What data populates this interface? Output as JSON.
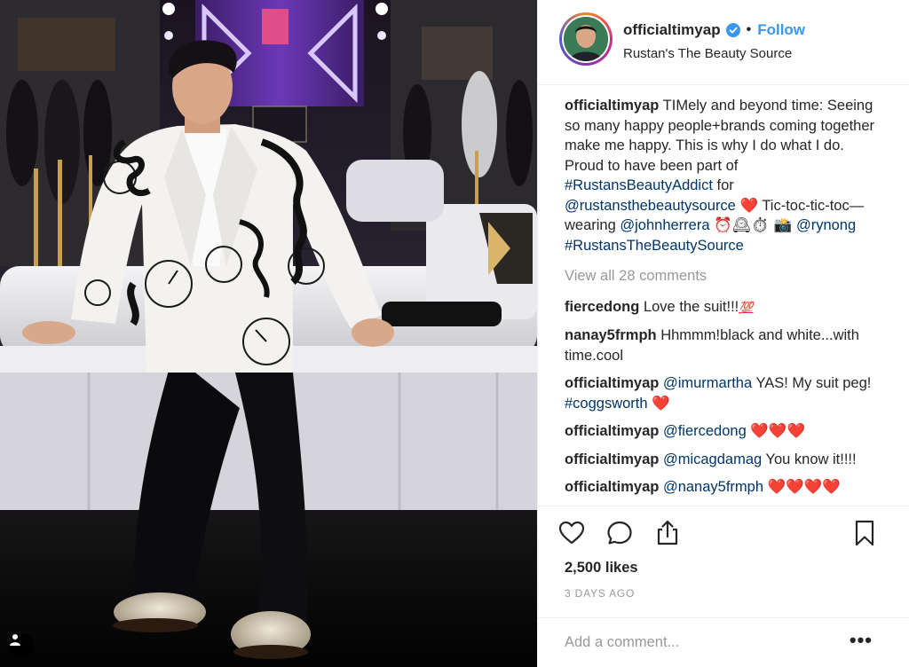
{
  "header": {
    "username": "officialtimyap",
    "follow_label": "Follow",
    "location": "Rustan's The Beauty Source"
  },
  "caption": {
    "username": "officialtimyap",
    "text_1": "TIMely and beyond time: Seeing so many happy people+brands coming together make me happy. This is why I do what I do. Proud to have been part of",
    "hashtag_1": "#RustansBeautyAddict",
    "text_2": "for",
    "mention_1": "@rustansthebeautysource",
    "heart": "❤️",
    "text_3": "Tic-toc-tic-toc—wearing",
    "mention_2": "@johnherrera",
    "emojis": "⏰🕰⏱ 📸",
    "mention_3": "@rynong",
    "hashtag_2": "#RustansTheBeautySource"
  },
  "view_all_label": "View all 28 comments",
  "comments": [
    {
      "username": "fiercedong",
      "text": "Love the suit!!!",
      "emoji": "💯"
    },
    {
      "username": "nanay5frmph",
      "text": "Hhmmm!black and white...with time.cool"
    },
    {
      "username": "officialtimyap",
      "mention": "@imurmartha",
      "text": "YAS! My suit peg!",
      "hashtag": "#coggsworth",
      "emoji": "❤️"
    },
    {
      "username": "officialtimyap",
      "mention": "@fiercedong",
      "emoji": "❤️❤️❤️"
    },
    {
      "username": "officialtimyap",
      "mention": "@micagdamag",
      "text": "You know it!!!!"
    },
    {
      "username": "officialtimyap",
      "mention": "@nanay5frmph",
      "emoji": "❤️❤️❤️❤️"
    }
  ],
  "icons": {
    "like": "heart-outline-icon",
    "comment": "speech-bubble-icon",
    "share": "share-upload-icon",
    "save": "bookmark-icon",
    "tag": "person-tag-icon",
    "more": "more-options-icon"
  },
  "likes_label": "2,500 likes",
  "time_ago": "3 DAYS AGO",
  "add_comment": {
    "placeholder": "Add a comment...",
    "more_label": "•••"
  },
  "colors": {
    "link": "#003569",
    "follow": "#3897f0",
    "muted": "#999999",
    "heart": "#e0245e"
  }
}
